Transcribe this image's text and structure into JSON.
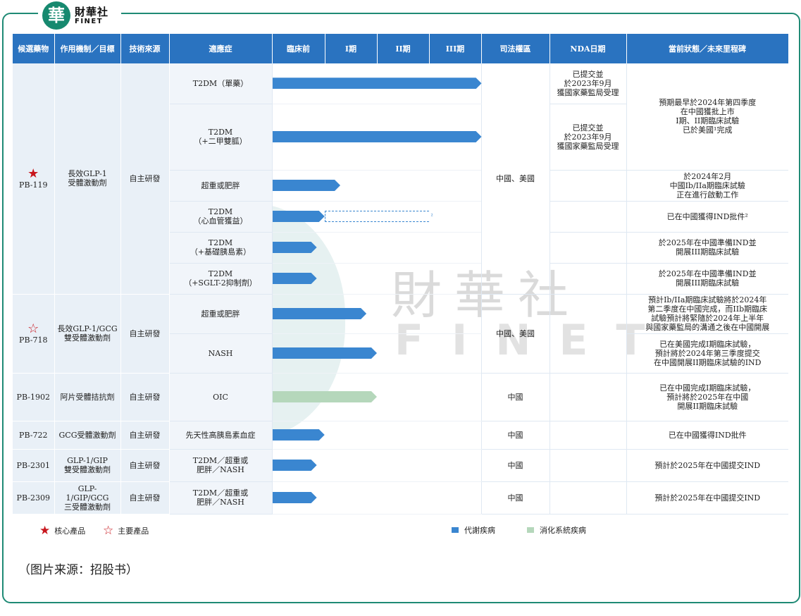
{
  "logo": {
    "badge": "華",
    "cn": "財華社",
    "en": "FINET"
  },
  "watermark": {
    "cn": "財華社",
    "en": "FINET"
  },
  "headers": [
    "候選藥物",
    "作用機制／目標",
    "技術來源",
    "適應症",
    "臨床前",
    "I期",
    "II期",
    "III期",
    "司法權區",
    "NDA日期",
    "當前狀態／未來里程碑"
  ],
  "pb119": {
    "name": "PB-119",
    "mechanism": "長效GLP-1\n受體激動劑",
    "source": "自主研發",
    "jurisdiction": "中國、美國",
    "indications": [
      "T2DM（單藥）",
      "T2DM\n（+二甲雙胍）",
      "超重或肥胖",
      "T2DM\n（心血管獲益）",
      "T2DM\n（+基礎胰島素）",
      "T2DM\n（+SGLT-2抑制劑）"
    ],
    "nda": [
      "已提交並\n於2023年9月\n獲國家藥監局受理",
      "已提交並\n於2023年9月\n獲國家藥監局受理"
    ],
    "status": [
      "預期最早於2024年第四季度\n在中國獲批上市\nI期、II期臨床試驗\n已於美國¹完成",
      "於2024年2月\n中國Ib/IIa期臨床試驗\n正在進行啟動工作",
      "已在中國獲得IND批件²",
      "於2025年在中國準備IND並\n開展III期臨床試驗",
      "於2025年在中國準備IND並\n開展III期臨床試驗"
    ],
    "footnote_mark": "²"
  },
  "pb718": {
    "name": "PB-718",
    "mechanism": "長效GLP-1/GCG\n雙受體激動劑",
    "source": "自主研發",
    "jurisdiction": "中國、美國",
    "indications": [
      "超重或肥胖",
      "NASH"
    ],
    "status": [
      "預計Ib/IIa期臨床試驗將於2024年\n第二季度在中國完成，而IIb期臨床\n試驗預計將緊隨於2024年上半年\n與國家藥監局的溝通之後在中國開展",
      "已在美國完成I期臨床試驗，\n預計將於2024年第三季度提交\n在中國開展II期臨床試驗的IND"
    ]
  },
  "pb1902": {
    "name": "PB-1902",
    "mechanism": "阿片受體拮抗劑",
    "source": "自主研發",
    "indication": "OIC",
    "jurisdiction": "中國",
    "status": "已在中國完成I期臨床試驗，\n預計將於2025年在中國\n開展II期臨床試驗"
  },
  "pb722": {
    "name": "PB-722",
    "mechanism": "GCG受體激動劑",
    "source": "自主研發",
    "indication": "先天性高胰島素血症",
    "jurisdiction": "中國",
    "status": "已在中國獲得IND批件"
  },
  "pb2301": {
    "name": "PB-2301",
    "mechanism": "GLP-1/GIP\n雙受體激動劑",
    "source": "自主研發",
    "indication": "T2DM／超重或\n肥胖／NASH",
    "jurisdiction": "中國",
    "status": "預計於2025年在中國提交IND"
  },
  "pb2309": {
    "name": "PB-2309",
    "mechanism": "GLP-1/GIP/GCG\n三受體激動劑",
    "source": "自主研發",
    "indication": "T2DM／超重或\n肥胖／NASH",
    "jurisdiction": "中國",
    "status": "預計於2025年在中國提交IND"
  },
  "progress": {
    "stages": [
      "臨床前",
      "I期",
      "II期",
      "III期"
    ],
    "rows": [
      {
        "drug": "PB-119",
        "indication": "T2DM（單藥）",
        "stages_completed": 4.0,
        "category": "代謝疾病"
      },
      {
        "drug": "PB-119",
        "indication": "T2DM（+二甲雙胍）",
        "stages_completed": 4.0,
        "category": "代謝疾病"
      },
      {
        "drug": "PB-119",
        "indication": "超重或肥胖",
        "stages_completed": 1.3,
        "category": "代謝疾病"
      },
      {
        "drug": "PB-119",
        "indication": "T2DM（心血管獲益）",
        "stages_completed": 1.0,
        "planned_to": 3.0,
        "category": "代謝疾病"
      },
      {
        "drug": "PB-119",
        "indication": "T2DM（+基礎胰島素）",
        "stages_completed": 0.85,
        "category": "代謝疾病"
      },
      {
        "drug": "PB-119",
        "indication": "T2DM（+SGLT-2抑制劑）",
        "stages_completed": 0.85,
        "category": "代謝疾病"
      },
      {
        "drug": "PB-718",
        "indication": "超重或肥胖",
        "stages_completed": 1.8,
        "category": "代謝疾病"
      },
      {
        "drug": "PB-718",
        "indication": "NASH",
        "stages_completed": 2.0,
        "category": "代謝疾病"
      },
      {
        "drug": "PB-1902",
        "indication": "OIC",
        "stages_completed": 2.0,
        "category": "消化系統疾病"
      },
      {
        "drug": "PB-722",
        "indication": "先天性高胰島素血症",
        "stages_completed": 1.0,
        "category": "代謝疾病"
      },
      {
        "drug": "PB-2301",
        "indication": "T2DM／超重或肥胖／NASH",
        "stages_completed": 0.85,
        "category": "代謝疾病"
      },
      {
        "drug": "PB-2309",
        "indication": "T2DM／超重或肥胖／NASH",
        "stages_completed": 0.85,
        "category": "代謝疾病"
      }
    ]
  },
  "legend": {
    "core": "核心產品",
    "major": "主要產品",
    "metabolic": "代謝疾病",
    "digestive": "消化系統疾病"
  },
  "colors": {
    "header": "#2a73c0",
    "metabolic_bar": "#3a86d0",
    "digestive_bar": "#b5d7bb",
    "star": "#c8161d",
    "frame": "#1f8a75"
  },
  "caption": "（图片来源：招股书）"
}
